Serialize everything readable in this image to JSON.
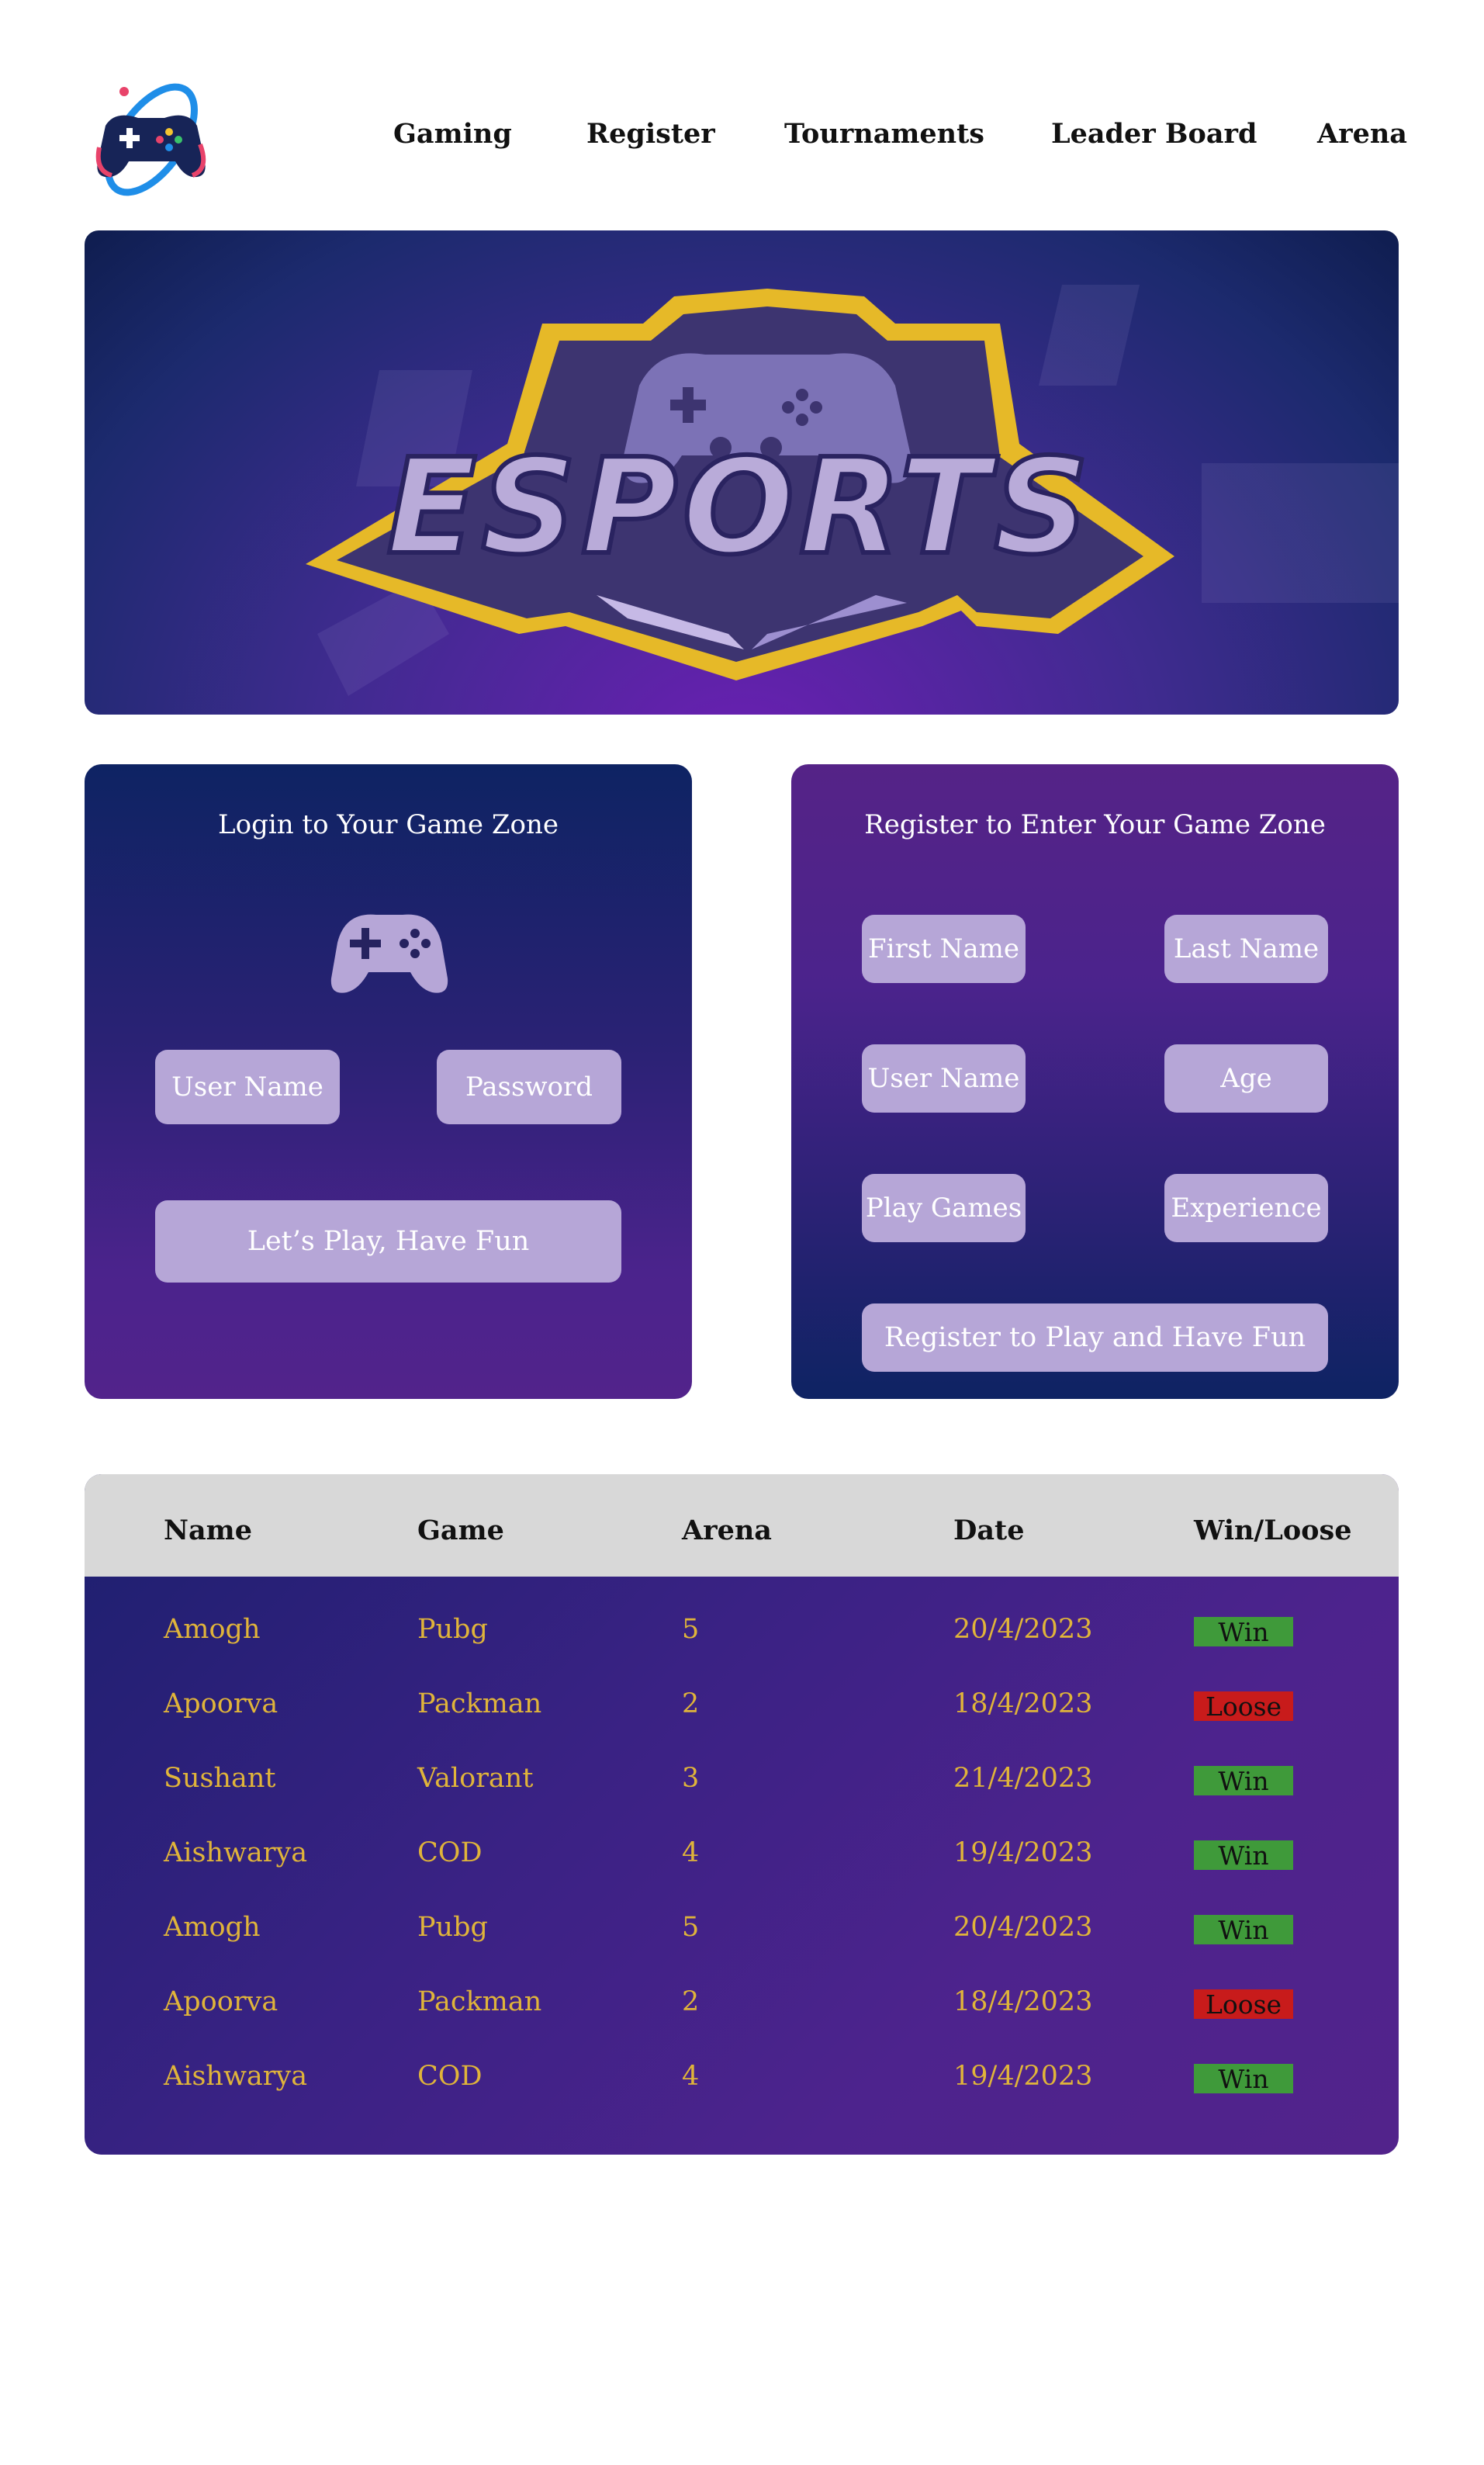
{
  "nav": {
    "logo_icon": "gamepad-orbit-logo",
    "items": [
      "Gaming",
      "Register",
      "Tournaments",
      "Leader Board",
      "Arena"
    ]
  },
  "hero": {
    "logo_text": "ESPORTS",
    "emblem_icon": "controller-emblem"
  },
  "login": {
    "title": "Login to Your Game Zone",
    "icon": "gamepad-icon",
    "username_placeholder": "User Name",
    "password_placeholder": "Password",
    "submit_label": "Let’s Play, Have Fun"
  },
  "register": {
    "title": "Register to Enter Your Game Zone",
    "first_name_placeholder": "First Name",
    "last_name_placeholder": "Last Name",
    "username_placeholder": "User Name",
    "age_placeholder": "Age",
    "play_games_placeholder": "Play Games",
    "experience_placeholder": "Experience",
    "submit_label": "Register to Play and Have Fun"
  },
  "leaderboard": {
    "headers": [
      "Name",
      "Game",
      "Arena",
      "Date",
      "Win/Loose"
    ],
    "rows": [
      {
        "name": "Amogh",
        "game": "Pubg",
        "arena": "5",
        "date": "20/4/2023",
        "result": "Win"
      },
      {
        "name": "Apoorva",
        "game": "Packman",
        "arena": "2",
        "date": "18/4/2023",
        "result": "Loose"
      },
      {
        "name": "Sushant",
        "game": "Valorant",
        "arena": "3",
        "date": "21/4/2023",
        "result": "Win"
      },
      {
        "name": "Aishwarya",
        "game": "COD",
        "arena": "4",
        "date": "19/4/2023",
        "result": "Win"
      },
      {
        "name": "Amogh",
        "game": "Pubg",
        "arena": "5",
        "date": "20/4/2023",
        "result": "Win"
      },
      {
        "name": "Apoorva",
        "game": "Packman",
        "arena": "2",
        "date": "18/4/2023",
        "result": "Loose"
      },
      {
        "name": "Aishwarya",
        "game": "COD",
        "arena": "4",
        "date": "19/4/2023",
        "result": "Win"
      }
    ]
  },
  "colors": {
    "accent_text": "#e0b43a",
    "win": "#3f9a3a",
    "loose": "#c81b1b",
    "field": "#b6a6d7"
  }
}
